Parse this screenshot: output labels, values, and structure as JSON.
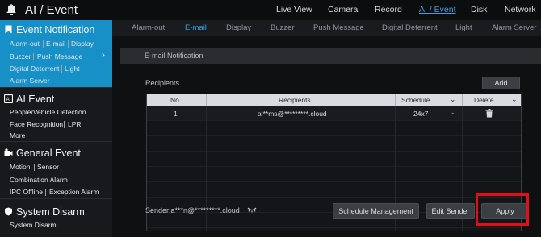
{
  "app": {
    "title": "AI / Event"
  },
  "topnav": [
    {
      "label": "Live View"
    },
    {
      "label": "Camera"
    },
    {
      "label": "Record"
    },
    {
      "label": "AI / Event",
      "active": true
    },
    {
      "label": "Disk"
    },
    {
      "label": "Network"
    }
  ],
  "sidebar": {
    "groups": [
      {
        "title": "Event Notification",
        "icon": "bookmark-icon",
        "items": [
          "Alarm-out",
          "E-mail",
          "Display",
          "Buzzer",
          "Push Message",
          "Digital Deterrent",
          "Light",
          "Alarm Server"
        ]
      },
      {
        "title": "AI Event",
        "icon": "ai-icon",
        "items": [
          "People/Vehicle Detection",
          "Face Recognition",
          "LPR",
          "More"
        ]
      },
      {
        "title": "General Event",
        "icon": "camera-gear-icon",
        "items": [
          "Motion",
          "Sensor",
          "Combination Alarm",
          "IPC Offline",
          "Exception Alarm"
        ]
      },
      {
        "title": "System Disarm",
        "icon": "shield-icon",
        "items": [
          "System Disarm"
        ]
      }
    ]
  },
  "tabs": [
    {
      "label": "Alarm-out"
    },
    {
      "label": "E-mail",
      "active": true
    },
    {
      "label": "Display"
    },
    {
      "label": "Buzzer"
    },
    {
      "label": "Push Message"
    },
    {
      "label": "Digital Deterrent"
    },
    {
      "label": "Light"
    },
    {
      "label": "Alarm Server"
    }
  ],
  "main": {
    "section_title": "E-mail Notification",
    "recipients_label": "Recipients",
    "add_button": "Add",
    "table": {
      "headers": {
        "no": "No.",
        "recipients": "Recipients",
        "schedule": "Schedule",
        "delete": "Delete"
      },
      "rows": [
        {
          "no": "1",
          "recipient": "al**ms@*********.cloud",
          "schedule": "24x7"
        }
      ]
    },
    "sender_label": "Sender:a***n@*********.cloud",
    "buttons": {
      "schedule_management": "Schedule Management",
      "edit_sender": "Edit Sender",
      "apply": "Apply"
    }
  },
  "colors": {
    "accent": "#1790c8",
    "link": "#3aa0e0",
    "highlight": "#e0101a"
  }
}
